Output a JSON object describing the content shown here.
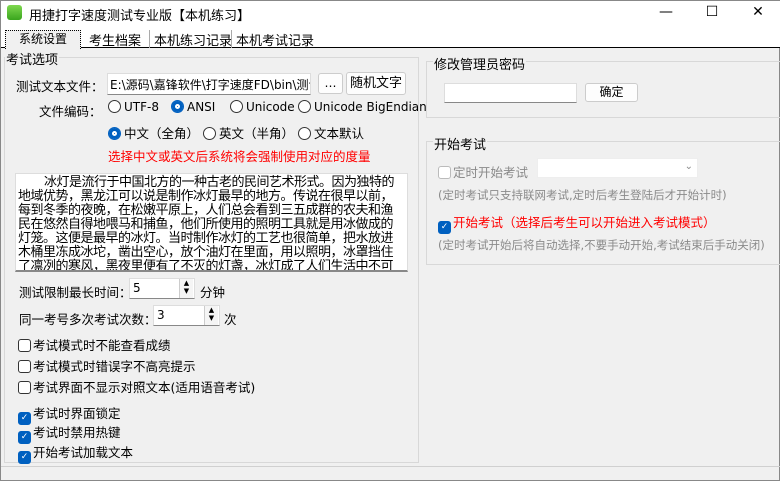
{
  "window": {
    "title": "用捷打字速度测试专业版【本机练习】",
    "minimize": "—",
    "maximize": "☐",
    "close": "✕"
  },
  "tabs": [
    {
      "label": "系统设置"
    },
    {
      "label": "考生档案"
    },
    {
      "label": "本机练习记录"
    },
    {
      "label": "本机考试记录"
    }
  ],
  "exam_options": {
    "title": "考试选项",
    "file_label": "测试文本文件：",
    "file_value": "E:\\源码\\嘉锋软件\\打字速度FD\\bin\\测试",
    "browse_button": "…",
    "random_button": "随机文字",
    "encoding_label": "文件编码：",
    "encodings": [
      {
        "label": "UTF-8",
        "checked": false
      },
      {
        "label": "ANSI",
        "checked": true
      },
      {
        "label": "Unicode",
        "checked": false
      },
      {
        "label": "Unicode BigEndian",
        "checked": false
      }
    ],
    "languages": [
      {
        "label": "中文（全角）",
        "checked": true
      },
      {
        "label": "英文（半角）",
        "checked": false
      },
      {
        "label": "文本默认",
        "checked": false
      }
    ],
    "language_hint": "选择中文或英文后系统将会强制使用对应的度量",
    "sample_text": "冰灯是流行于中国北方的一种古老的民间艺术形式。因为独特的地域优势，黑龙江可以说是制作冰灯最早的地方。传说在很早以前，每到冬季的夜晚，在松嫩平原上，人们总会看到三五成群的农夫和渔民在悠然自得地喂马和捕鱼，他们所使用的照明工具就是用冰做成的灯笼。这便是最早的冰灯。当时制作冰灯的工艺也很简单，把水放进木桶里冻成冰坨，凿出空心，放个油灯在里面，用以照明，冰罩挡住了凛冽的寒风，黑夜里便有了不灭的灯盏，冰灯成了人们生活中不可缺少的帮手。后来，每逢新春佳节",
    "time_limit_label": "测试限制最长时间：",
    "time_limit_value": "5",
    "time_limit_unit": "分钟",
    "attempts_label": "同一考号多次考试次数：",
    "attempts_value": "3",
    "attempts_unit": "次",
    "checkboxes": [
      {
        "label": "考试模式时不能查看成绩",
        "checked": false
      },
      {
        "label": "考试模式时错误字不高亮提示",
        "checked": false
      },
      {
        "label": "考试界面不显示对照文本(适用语音考试)",
        "checked": false
      },
      {
        "label": "考试时界面锁定",
        "checked": true
      },
      {
        "label": "考试时禁用热键",
        "checked": true
      },
      {
        "label": "开始考试加载文本",
        "checked": true
      }
    ]
  },
  "admin_password": {
    "title": "修改管理员密码",
    "value": "",
    "confirm_button": "确定"
  },
  "start_exam": {
    "title": "开始考试",
    "timed_label": "定时开始考试",
    "timed_checked": false,
    "timed_select": "",
    "timed_note": "(定时考试只支持联网考试,定时后考生登陆后才开始计时)",
    "start_label": "开始考试（选择后考生可以开始进入考试模式）",
    "start_checked": true,
    "start_note": "(定时考试开始后将自动选择,不要手动开始,考试结束后手动关闭)"
  }
}
